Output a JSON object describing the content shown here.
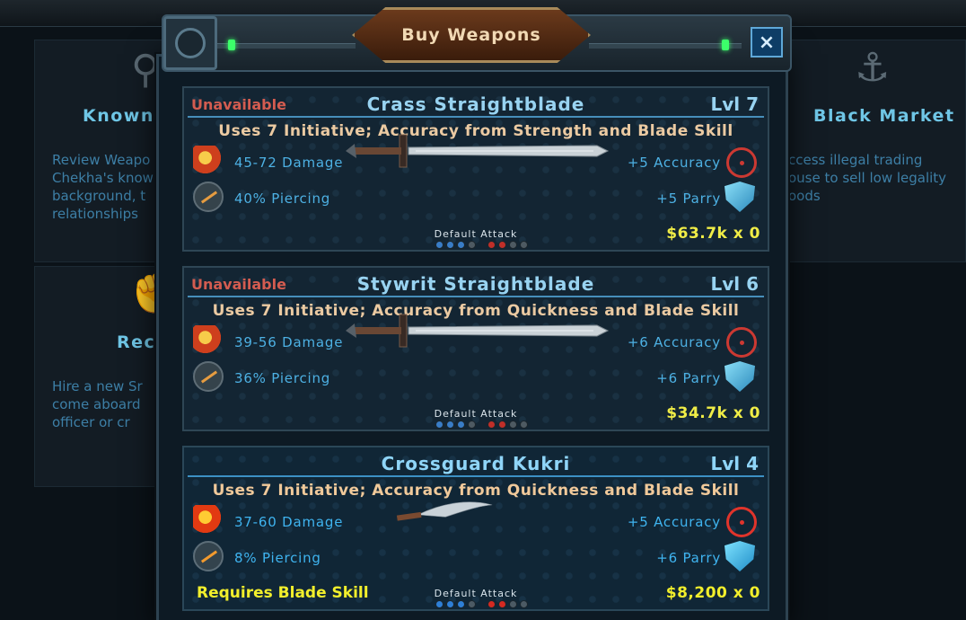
{
  "window_title": "Buy Weapons",
  "close_label": "×",
  "background": {
    "known_title": "Known",
    "known_desc": [
      "Review Weapo",
      "Chekha's know",
      "background, t",
      "relationships"
    ],
    "recruit_title": "Recr",
    "recruit_desc": [
      "Hire a new Sr",
      "come aboard",
      "officer or cr"
    ],
    "market_title": "Black Market",
    "market_desc": [
      "ccess illegal trading",
      "ouse to sell low legality",
      "oods"
    ]
  },
  "default_attack_label": "Default Attack",
  "weapons": [
    {
      "status": "Unavailable",
      "name": "Crass Straightblade",
      "level": "Lvl 7",
      "uses": "Uses 7 Initiative; Accuracy from Strength and Blade Skill",
      "damage": "45-72 Damage",
      "piercing": "40% Piercing",
      "accuracy": "+5 Accuracy",
      "parry": "+5 Parry",
      "price": "$63.7k x 0",
      "requirement": ""
    },
    {
      "status": "Unavailable",
      "name": "Stywrit Straightblade",
      "level": "Lvl 6",
      "uses": "Uses 7 Initiative; Accuracy from Quickness and Blade Skill",
      "damage": "39-56 Damage",
      "piercing": "36% Piercing",
      "accuracy": "+6 Accuracy",
      "parry": "+6 Parry",
      "price": "$34.7k x 0",
      "requirement": ""
    },
    {
      "status": "",
      "name": "Crossguard Kukri",
      "level": "Lvl 4",
      "uses": "Uses 7 Initiative; Accuracy from Quickness and Blade Skill",
      "damage": "37-60 Damage",
      "piercing": "8% Piercing",
      "accuracy": "+5 Accuracy",
      "parry": "+6 Parry",
      "price": "$8,200 x 0",
      "requirement": "Requires Blade Skill"
    }
  ]
}
